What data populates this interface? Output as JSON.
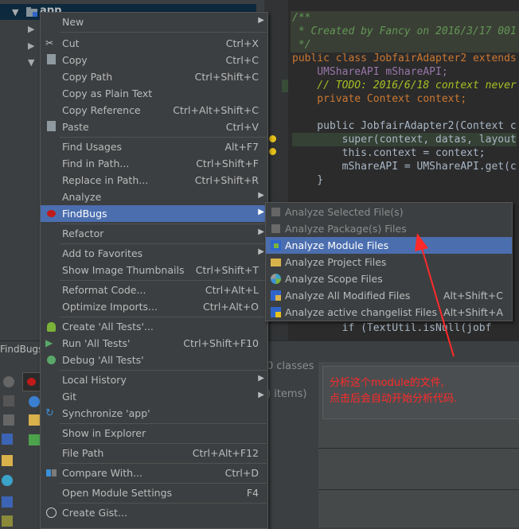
{
  "tree": {
    "root_label": "app",
    "panel_title": "FindBugs-I"
  },
  "editor": {
    "lines": [
      {
        "t": "/**"
      },
      {
        "t": " * Created by Fancy on 2016/3/17 001"
      },
      {
        "t": " */"
      },
      {
        "t": "public class JobfairAdapter2 extends"
      },
      {
        "t": "    UMShareAPI mShareAPI;"
      },
      {
        "t": "    // TODO: 2016/6/18 context never"
      },
      {
        "t": "    private Context context;"
      },
      {
        "t": "    public JobfairAdapter2(Context c"
      },
      {
        "t": "        super(context, datas, layout"
      },
      {
        "t": "        this.context = context;"
      },
      {
        "t": "        mShareAPI = UMShareAPI.get(c"
      },
      {
        "t": "    }"
      },
      {
        "t": "        if (TextUtil.isNull(jobf"
      }
    ]
  },
  "findbugs_panel": {
    "classes_text": "0 classes",
    "items_text": ") items)",
    "annotation_line1": "分析这个module的文件,",
    "annotation_line2": "点击后会自动开始分析代码."
  },
  "menu": {
    "items": [
      {
        "label": "New",
        "shortcut": "",
        "arrow": true
      },
      {
        "label": "Cut",
        "shortcut": "Ctrl+X"
      },
      {
        "label": "Copy",
        "shortcut": "Ctrl+C"
      },
      {
        "label": "Copy Path",
        "shortcut": "Ctrl+Shift+C"
      },
      {
        "label": "Copy as Plain Text",
        "shortcut": ""
      },
      {
        "label": "Copy Reference",
        "shortcut": "Ctrl+Alt+Shift+C"
      },
      {
        "label": "Paste",
        "shortcut": "Ctrl+V"
      },
      {
        "label": "Find Usages",
        "shortcut": "Alt+F7"
      },
      {
        "label": "Find in Path...",
        "shortcut": "Ctrl+Shift+F"
      },
      {
        "label": "Replace in Path...",
        "shortcut": "Ctrl+Shift+R"
      },
      {
        "label": "Analyze",
        "shortcut": "",
        "arrow": true
      },
      {
        "label": "FindBugs",
        "shortcut": "",
        "arrow": true
      },
      {
        "label": "Refactor",
        "shortcut": "",
        "arrow": true
      },
      {
        "label": "Add to Favorites",
        "shortcut": "",
        "arrow": true
      },
      {
        "label": "Show Image Thumbnails",
        "shortcut": "Ctrl+Shift+T"
      },
      {
        "label": "Reformat Code...",
        "shortcut": "Ctrl+Alt+L"
      },
      {
        "label": "Optimize Imports...",
        "shortcut": "Ctrl+Alt+O"
      },
      {
        "label": "Create 'All Tests'...",
        "shortcut": ""
      },
      {
        "label": "Run 'All Tests'",
        "shortcut": "Ctrl+Shift+F10"
      },
      {
        "label": "Debug 'All Tests'",
        "shortcut": ""
      },
      {
        "label": "Local History",
        "shortcut": "",
        "arrow": true
      },
      {
        "label": "Git",
        "shortcut": "",
        "arrow": true
      },
      {
        "label": "Synchronize 'app'",
        "shortcut": ""
      },
      {
        "label": "Show in Explorer",
        "shortcut": ""
      },
      {
        "label": "File Path",
        "shortcut": "Ctrl+Alt+F12"
      },
      {
        "label": "Compare With...",
        "shortcut": "Ctrl+D"
      },
      {
        "label": "Open Module Settings",
        "shortcut": "F4"
      },
      {
        "label": "Create Gist...",
        "shortcut": ""
      }
    ]
  },
  "submenu": {
    "items": [
      {
        "label": "Analyze Selected File(s)",
        "shortcut": ""
      },
      {
        "label": "Analyze Package(s) Files",
        "shortcut": ""
      },
      {
        "label": "Analyze Module Files",
        "shortcut": ""
      },
      {
        "label": "Analyze Project Files",
        "shortcut": ""
      },
      {
        "label": "Analyze Scope Files",
        "shortcut": ""
      },
      {
        "label": "Analyze All Modified Files",
        "shortcut": "Alt+Shift+C"
      },
      {
        "label": "Analyze active changelist Files",
        "shortcut": "Alt+Shift+A"
      }
    ]
  },
  "colors": {
    "selection": "#4b6eaf",
    "annotation": "#ff2a2a",
    "menu_bg": "#3c3f41"
  }
}
